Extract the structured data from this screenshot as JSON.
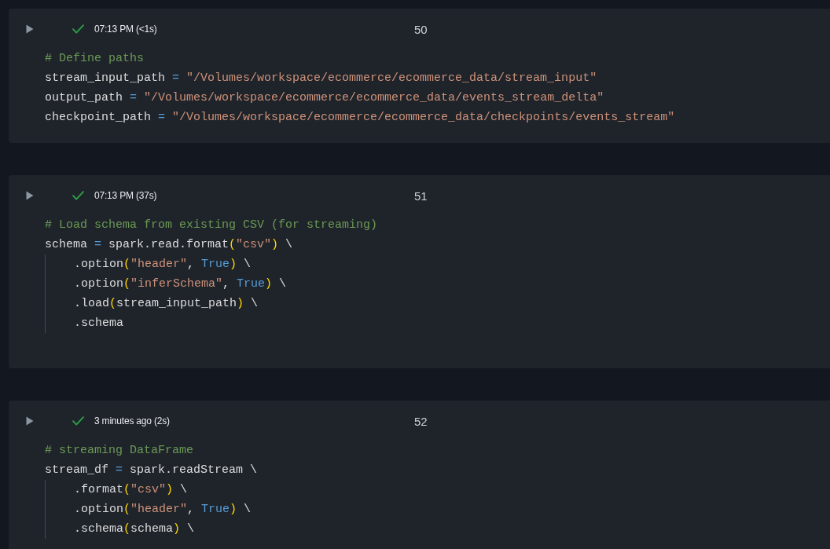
{
  "cells": [
    {
      "succeeded": true,
      "status_text": "07:13 PM (<1s)",
      "execution_count": "50",
      "lines": [
        {
          "kind": "code",
          "tokens": [
            {
              "kind": "comment",
              "text": "# Define paths"
            }
          ]
        },
        {
          "kind": "code",
          "tokens": [
            {
              "kind": "plain",
              "text": "stream_input_path "
            },
            {
              "kind": "operator",
              "text": "= "
            },
            {
              "kind": "string",
              "text": "\"/Volumes/workspace/ecommerce/ecommerce_data/stream_input\""
            }
          ]
        },
        {
          "kind": "code",
          "tokens": [
            {
              "kind": "plain",
              "text": "output_path "
            },
            {
              "kind": "operator",
              "text": "= "
            },
            {
              "kind": "string",
              "text": "\"/Volumes/workspace/ecommerce/ecommerce_data/events_stream_delta\""
            }
          ]
        },
        {
          "kind": "code",
          "tokens": [
            {
              "kind": "plain",
              "text": "checkpoint_path "
            },
            {
              "kind": "operator",
              "text": "= "
            },
            {
              "kind": "string",
              "text": "\"/Volumes/workspace/ecommerce/ecommerce_data/checkpoints/events_stream\""
            }
          ]
        }
      ]
    },
    {
      "succeeded": true,
      "status_text": "07:13 PM (37s)",
      "execution_count": "51",
      "lines": [
        {
          "kind": "code",
          "tokens": [
            {
              "kind": "comment",
              "text": "# Load schema from existing CSV (for streaming)"
            }
          ]
        },
        {
          "kind": "code",
          "tokens": [
            {
              "kind": "plain",
              "text": "schema "
            },
            {
              "kind": "operator",
              "text": "="
            },
            {
              "kind": "plain",
              "text": " spark.read.format"
            },
            {
              "kind": "paren",
              "text": "("
            },
            {
              "kind": "string",
              "text": "\"csv\""
            },
            {
              "kind": "paren",
              "text": ")"
            },
            {
              "kind": "plain",
              "text": " \\"
            }
          ],
          "children": [
            {
              "kind": "code",
              "tokens": [
                {
                  "kind": "plain",
                  "text": ".option"
                },
                {
                  "kind": "paren",
                  "text": "("
                },
                {
                  "kind": "string",
                  "text": "\"header\""
                },
                {
                  "kind": "plain",
                  "text": ", "
                },
                {
                  "kind": "keyword",
                  "text": "True"
                },
                {
                  "kind": "paren",
                  "text": ")"
                },
                {
                  "kind": "plain",
                  "text": " \\"
                }
              ]
            },
            {
              "kind": "code",
              "tokens": [
                {
                  "kind": "plain",
                  "text": ".option"
                },
                {
                  "kind": "paren",
                  "text": "("
                },
                {
                  "kind": "string",
                  "text": "\"inferSchema\""
                },
                {
                  "kind": "plain",
                  "text": ", "
                },
                {
                  "kind": "keyword",
                  "text": "True"
                },
                {
                  "kind": "paren",
                  "text": ")"
                },
                {
                  "kind": "plain",
                  "text": " \\"
                }
              ]
            },
            {
              "kind": "code",
              "tokens": [
                {
                  "kind": "plain",
                  "text": ".load"
                },
                {
                  "kind": "paren",
                  "text": "("
                },
                {
                  "kind": "plain",
                  "text": "stream_input_path"
                },
                {
                  "kind": "paren",
                  "text": ")"
                },
                {
                  "kind": "plain",
                  "text": " \\"
                }
              ]
            },
            {
              "kind": "code",
              "tokens": [
                {
                  "kind": "plain",
                  "text": ".schema"
                }
              ]
            }
          ]
        },
        {
          "kind": "blank"
        }
      ]
    },
    {
      "succeeded": true,
      "status_text": "3 minutes ago (2s)",
      "execution_count": "52",
      "lines": [
        {
          "kind": "code",
          "tokens": [
            {
              "kind": "comment",
              "text": "# streaming DataFrame"
            }
          ]
        },
        {
          "kind": "code",
          "tokens": [
            {
              "kind": "plain",
              "text": "stream_df "
            },
            {
              "kind": "operator",
              "text": "="
            },
            {
              "kind": "plain",
              "text": " spark.readStream \\"
            }
          ],
          "children": [
            {
              "kind": "code",
              "tokens": [
                {
                  "kind": "plain",
                  "text": ".format"
                },
                {
                  "kind": "paren",
                  "text": "("
                },
                {
                  "kind": "string",
                  "text": "\"csv\""
                },
                {
                  "kind": "paren",
                  "text": ")"
                },
                {
                  "kind": "plain",
                  "text": " \\"
                }
              ]
            },
            {
              "kind": "code",
              "tokens": [
                {
                  "kind": "plain",
                  "text": ".option"
                },
                {
                  "kind": "paren",
                  "text": "("
                },
                {
                  "kind": "string",
                  "text": "\"header\""
                },
                {
                  "kind": "plain",
                  "text": ", "
                },
                {
                  "kind": "keyword",
                  "text": "True"
                },
                {
                  "kind": "paren",
                  "text": ")"
                },
                {
                  "kind": "plain",
                  "text": " \\"
                }
              ]
            },
            {
              "kind": "code",
              "tokens": [
                {
                  "kind": "plain",
                  "text": ".schema"
                },
                {
                  "kind": "paren",
                  "text": "("
                },
                {
                  "kind": "plain",
                  "text": "schema"
                },
                {
                  "kind": "paren",
                  "text": ")"
                },
                {
                  "kind": "plain",
                  "text": " \\"
                }
              ]
            }
          ]
        }
      ]
    }
  ]
}
